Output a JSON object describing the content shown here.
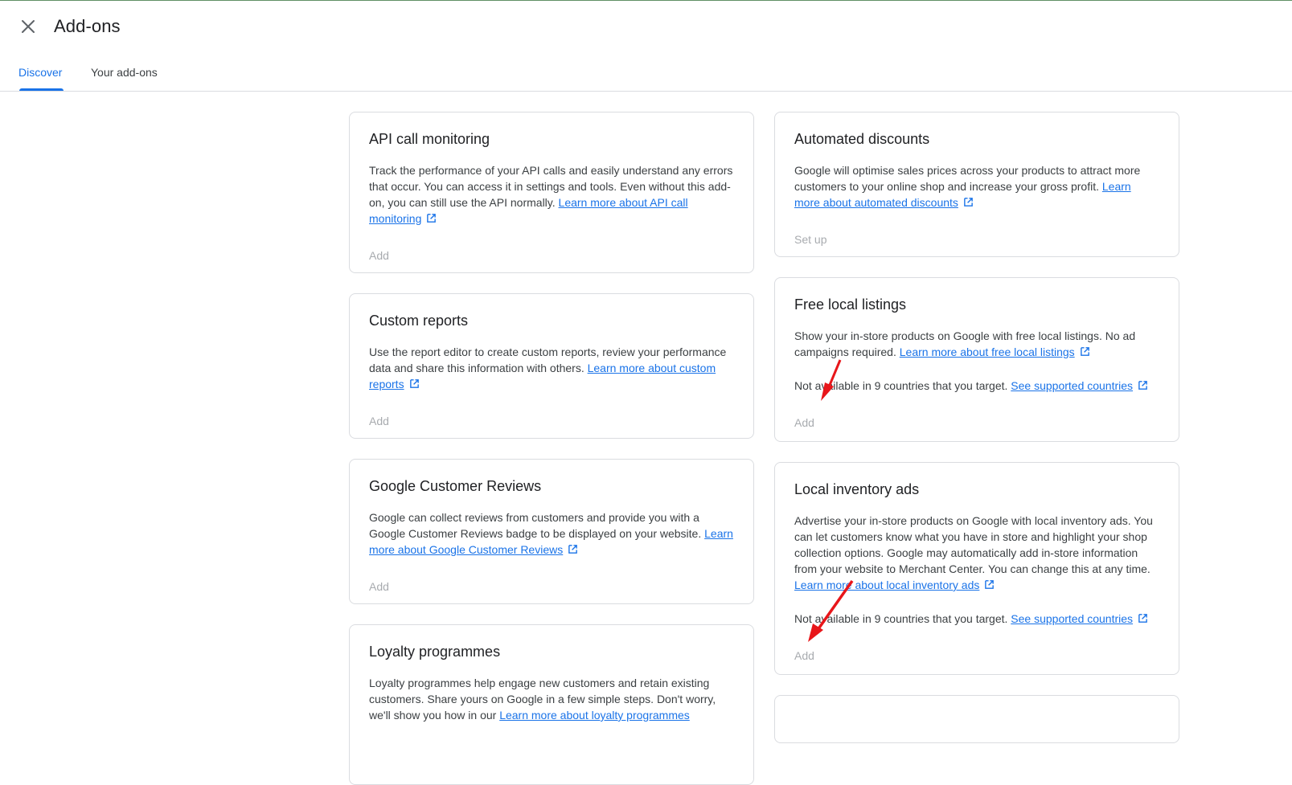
{
  "header": {
    "title": "Add-ons",
    "close_icon": "close-icon"
  },
  "tabs": [
    {
      "label": "Discover",
      "active": true
    },
    {
      "label": "Your add-ons",
      "active": false
    }
  ],
  "colors": {
    "accent": "#1a73e8",
    "disabled_action": "#a8abaf",
    "annotation_arrow": "#e8161a"
  },
  "cards": {
    "api": {
      "title": "API call monitoring",
      "desc": "Track the performance of your API calls and easily understand any errors that occur. You can access it in settings and tools. Even without this add-on, you can still use the API normally. ",
      "link": "Learn more about API call monitoring",
      "action": "Add"
    },
    "custom": {
      "title": "Custom reports",
      "desc": "Use the report editor to create custom reports, review your performance data and share this information with others. ",
      "link": "Learn more about custom reports",
      "action": "Add"
    },
    "gcr": {
      "title": "Google Customer Reviews",
      "desc": "Google can collect reviews from customers and provide you with a Google Customer Reviews badge to be displayed on your website. ",
      "link": "Learn more about Google Customer Reviews",
      "action": "Add"
    },
    "loyalty": {
      "title": "Loyalty programmes",
      "desc": "Loyalty programmes help engage new customers and retain existing customers. Share yours on Google in a few simple steps. Don't worry, we'll show you how in our ",
      "link": "Learn more about loyalty programmes"
    },
    "auto": {
      "title": "Automated discounts",
      "desc": "Google will optimise sales prices across your products to attract more customers to your online shop and increase your gross profit. ",
      "link": "Learn more about automated discounts",
      "action": "Set up"
    },
    "fll": {
      "title": "Free local listings",
      "desc": "Show your in-store products on Google with free local listings. No ad campaigns required. ",
      "link": "Learn more about free local listings",
      "note": "Not available in 9 countries that you target. ",
      "note_link": "See supported countries",
      "action": "Add"
    },
    "lia": {
      "title": "Local inventory ads",
      "desc": "Advertise your in-store products on Google with local inventory ads. You can let customers know what you have in store and highlight your shop collection options. Google may automatically add in-store information from your website to Merchant Center. You can change this at any time. ",
      "link": "Learn more about local inventory ads",
      "note": "Not available in 9 countries that you target. ",
      "note_link": "See supported countries",
      "action": "Add"
    }
  }
}
